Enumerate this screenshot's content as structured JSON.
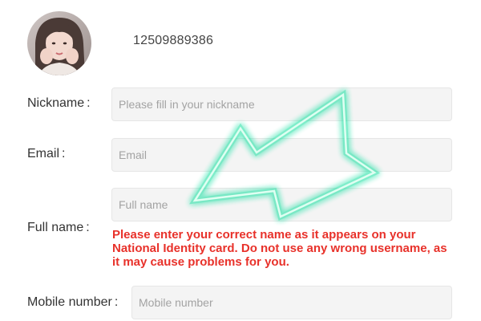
{
  "profile": {
    "user_id": "12509889386"
  },
  "form": {
    "nickname": {
      "label": "Nickname",
      "colon": ":",
      "value": "",
      "placeholder": "Please fill in your nickname"
    },
    "email": {
      "label": "Email",
      "colon": ":",
      "value": "",
      "placeholder": "Email"
    },
    "full_name": {
      "label": "Full name",
      "colon": ":",
      "value": "",
      "placeholder": "Full name",
      "warning": "Please enter your correct name as it appears on your National Identity card. Do not use any wrong username, as it may cause problems for you."
    },
    "mobile": {
      "label": "Mobile number",
      "colon": ":",
      "value": "",
      "placeholder": "Mobile number"
    }
  },
  "colors": {
    "warning_text": "#e8312a",
    "arrow_glow": "#19e0a0",
    "input_background": "#f4f4f4"
  },
  "icons": {
    "overlay_arrow": "glowing-arrow-pointing-down-left"
  }
}
